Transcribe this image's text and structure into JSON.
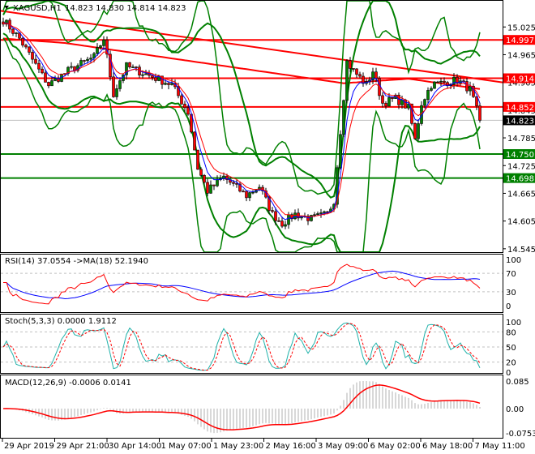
{
  "header": {
    "symbol_label": "XAGUSD,H1",
    "ohlc": "14.823 14.830 14.814 14.823"
  },
  "colors": {
    "bull": "#008000",
    "bear": "#ff0000",
    "resistance": "#ff0000",
    "support": "#008000",
    "ma_fast": "#0000ff",
    "ma_slow": "#ff0000",
    "band": "#008000",
    "stoch_main": "#20b2aa"
  },
  "chart_data": {
    "type": "candlestick",
    "title": "XAGUSD,H1",
    "price_axis_ticks": [
      "15.025",
      "14.965",
      "14.905",
      "14.845",
      "14.785",
      "14.725",
      "14.665",
      "14.605",
      "14.545"
    ],
    "ylim": [
      14.545,
      15.06
    ],
    "price_keypoints": [
      [
        0,
        15.04
      ],
      [
        5,
        15.0
      ],
      [
        12,
        14.92
      ],
      [
        14,
        14.9
      ],
      [
        20,
        14.93
      ],
      [
        28,
        14.96
      ],
      [
        31,
        15.0
      ],
      [
        34,
        14.88
      ],
      [
        38,
        14.94
      ],
      [
        45,
        14.92
      ],
      [
        52,
        14.9
      ],
      [
        57,
        14.84
      ],
      [
        60,
        14.72
      ],
      [
        63,
        14.67
      ],
      [
        68,
        14.7
      ],
      [
        75,
        14.66
      ],
      [
        79,
        14.68
      ],
      [
        83,
        14.62
      ],
      [
        86,
        14.6
      ],
      [
        90,
        14.62
      ],
      [
        95,
        14.61
      ],
      [
        100,
        14.62
      ],
      [
        102,
        14.65
      ],
      [
        104,
        14.8
      ],
      [
        106,
        14.95
      ],
      [
        108,
        14.93
      ],
      [
        112,
        14.9
      ],
      [
        114,
        14.93
      ],
      [
        117,
        14.86
      ],
      [
        121,
        14.87
      ],
      [
        125,
        14.85
      ],
      [
        127,
        14.78
      ],
      [
        129,
        14.86
      ],
      [
        132,
        14.9
      ],
      [
        140,
        14.91
      ],
      [
        144,
        14.89
      ],
      [
        147,
        14.823
      ]
    ],
    "levels": [
      {
        "label": "14.997",
        "value": 14.997,
        "kind": "resistance"
      },
      {
        "label": "14.914",
        "value": 14.914,
        "kind": "resistance"
      },
      {
        "label": "14.852",
        "value": 14.852,
        "kind": "resistance"
      },
      {
        "label": "14.750",
        "value": 14.75,
        "kind": "support"
      },
      {
        "label": "14.698",
        "value": 14.698,
        "kind": "support"
      }
    ],
    "current_price": {
      "label": "14.823",
      "value": 14.823
    },
    "trendline": {
      "start": 15.06,
      "end": 14.905
    },
    "x_ticks": [
      "29 Apr 2019",
      "29 Apr 21:00",
      "30 Apr 14:00",
      "1 May 07:00",
      "1 May 23:00",
      "2 May 16:00",
      "3 May 09:00",
      "6 May 02:00",
      "6 May 18:00",
      "7 May 11:00"
    ],
    "rsi": {
      "label": "RSI(14) 37.0554  ->MA(18) 52.1940",
      "ticks": [
        "100",
        "70",
        "30",
        "0"
      ]
    },
    "stoch": {
      "label": "Stoch(5,3,3) 0.0000 1.9112",
      "ticks": [
        "100",
        "80",
        "50",
        "20",
        "0"
      ]
    },
    "macd": {
      "label": "MACD(12,26,9) -0.0006 0.0141",
      "ticks": [
        "0.085",
        "0.00",
        "-0.0753"
      ]
    }
  }
}
